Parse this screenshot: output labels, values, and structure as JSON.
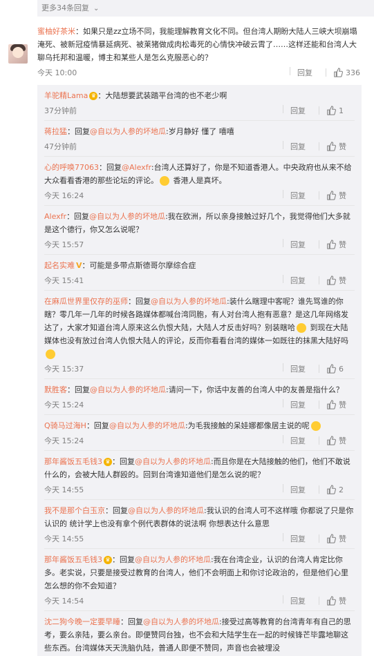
{
  "more_replies_top": "更多34条回复",
  "main": {
    "user": "蜜柚好茶米",
    "text": "：如果只是zz立场不同，我能理解教育文化不同。但台湾人期盼大陆人三峡大坝崩塌淹死、被新冠疫情暴延病死、被莱猪做成肉松毒死的心情快冲破云霄了……这样还能和台湾人大聊乌托邦和温暖，博主和某些人是怎么克服恶心的？",
    "time": "今天 10:00",
    "reply_label": "回复",
    "likes": "336"
  },
  "replies": [
    {
      "user": "羊驼精Lama",
      "badge": true,
      "replyto": "",
      "text": "：大陆想要武装踏平台湾的也不老少啊",
      "time": "37分钟前",
      "likes": "1"
    },
    {
      "user": "蒋拉猛",
      "replyto": "@自以为人参的坏地瓜",
      "text": ":岁月静好 懂了 嘻嘻",
      "time": "47分钟前",
      "likes": "赞"
    },
    {
      "user": "心的呼唤77063",
      "replyto": "@Alexfr",
      "text": ":台湾人还算好了，你是不知道香港人。中央政府也从来不给大众看看香港的那些论坛的评论。",
      "emoji": true,
      "text2": " 香港人是真坏。",
      "time": "今天 16:24",
      "likes": "赞"
    },
    {
      "user": "Alexfr",
      "replyto": "@自以为人参的坏地瓜",
      "text": ":我在欧洲，所以亲身接触过好几个，我觉得他们大多就是这个德行，你又怎么说呢？",
      "time": "今天 15:57",
      "likes": "赞"
    },
    {
      "user": "起名实难",
      "vbadge": true,
      "replyto": "",
      "text": "：可能是多带点斯德哥尔摩综合症",
      "time": "今天 15:41",
      "likes": "赞"
    },
    {
      "user": "在麻瓜世界里仅存的巫师",
      "replyto": "@自以为人参的坏地瓜",
      "text": ":装什么瞎理中客呢？谁先骂谁的你瞎？零几年一几年的时候各路媒体都喊台湾同胞，有人对台湾人抱有恶意？是这几年网络发达了，大家才知道台湾人原来这么仇恨大陆，大陆人才反击好吗？别装瞎哈",
      "emoji": true,
      "text2": " 到现在大陆媒体也没有放过台湾人仇恨大陆人的评论，反而你看看台湾的媒体一如既往的抹黑大陆好吗",
      "emoji2": true,
      "time": "今天 15:37",
      "likes": "6"
    },
    {
      "user": "默胜客",
      "replyto": "@自以为人参的坏地瓜",
      "text": ":请问一下，你话中友善的台湾人中的友善是指什么？",
      "time": "今天 15:24",
      "likes": "赞"
    },
    {
      "user": "Q骑马过海H",
      "replyto": "@自以为人参的坏地瓜",
      "text": ":为毛我接触的呆娃娜都像居主说的呢",
      "emoji": true,
      "time": "今天 15:24",
      "likes": "赞"
    },
    {
      "user": "那年酱饭五毛钱3",
      "badge": true,
      "replyto": "@自以为人参的坏地瓜",
      "text": ":而且你是在大陆接触的他们，他们不敢说什么的，会被大陆人群殴的。回到台湾谁知道他们是怎么说的呢？",
      "time": "今天 14:55",
      "likes": "2"
    },
    {
      "user": "我不是那个白玉京",
      "replyto": "@自以为人参的坏地瓜",
      "text": ":我认识的台湾人可不这样哦 你都说了只是你认识的 统计学上也没有拿个例代表群体的说法啊 你想表达什么意思",
      "time": "今天 14:55",
      "likes": "赞"
    },
    {
      "user": "那年酱饭五毛钱3",
      "badge": true,
      "replyto": "@自以为人参的坏地瓜",
      "text": ":我在台湾企业，认识的台湾人肯定比你多。老实说，只要是接受过教育的台湾人，他们不会明面上和你讨论政治的，但是他们心里怎么想的你不会知道？",
      "time": "今天 14:54",
      "likes": "赞"
    },
    {
      "user": "沈二狗今晚一定要早睡",
      "replyto": "@自以为人参的坏地瓜",
      "text": ":接受过高等教育的台湾青年有自己的思考，要么亲陆，要么亲台。即便赞同台独，也不会和大陆学生在一起的时候锋芒毕露地聊这些东西。台湾媒体天天洗脑仇陆，普通人即便不赞同，声音也会被埋没",
      "time": "",
      "likes": ""
    }
  ],
  "reply_prefix": "：回复",
  "reply_label": "回复"
}
